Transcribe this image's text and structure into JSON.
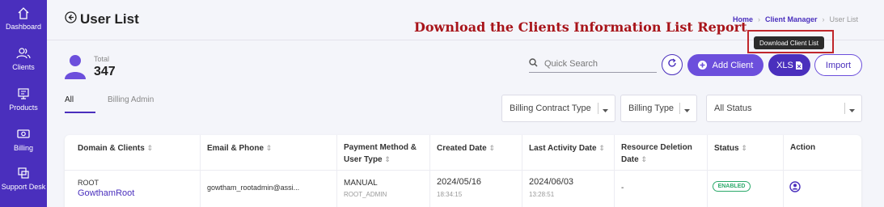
{
  "sidebar": {
    "items": [
      {
        "label": "Dashboard",
        "icon": "home-icon"
      },
      {
        "label": "Clients",
        "icon": "users-icon"
      },
      {
        "label": "Products",
        "icon": "monitor-icon"
      },
      {
        "label": "Billing",
        "icon": "money-icon"
      },
      {
        "label": "Support Desk",
        "icon": "copy-icon"
      }
    ]
  },
  "header": {
    "title": "User List",
    "banner": "Download the Clients Information List Report",
    "breadcrumb": [
      "Home",
      "Client Manager",
      "User List"
    ]
  },
  "summary": {
    "total_label": "Total",
    "total_value": "347"
  },
  "search": {
    "placeholder": "Quick Search"
  },
  "buttons": {
    "add_client": "Add Client",
    "xls": "XLS",
    "import": "Import",
    "tooltip": "Download Client List"
  },
  "tabs": [
    {
      "label": "All",
      "active": true
    },
    {
      "label": "Billing Admin",
      "active": false
    }
  ],
  "filters": {
    "billing_contract_type": "Billing Contract Type",
    "billing_type": "Billing Type",
    "status": "All Status"
  },
  "table": {
    "columns": [
      "Domain & Clients",
      "Email & Phone",
      "Payment Method & User Type",
      "Created Date",
      "Last Activity Date",
      "Resource Deletion Date",
      "Status",
      "Action"
    ],
    "rows": [
      {
        "domain": "ROOT",
        "client": "GowthamRoot",
        "email": "gowtham_rootadmin@assi...",
        "payment_method": "MANUAL",
        "user_type": "ROOT_ADMIN",
        "created_date": "2024/05/16",
        "created_time": "18:34:15",
        "last_activity_date": "2024/06/03",
        "last_activity_time": "13:28:51",
        "resource_deletion_date": "-",
        "status": "ENABLED"
      }
    ]
  },
  "colors": {
    "primary": "#4a2fbd",
    "accent": "#6c4fdc",
    "banner": "#a8141a",
    "enabled": "#2ba96a"
  }
}
